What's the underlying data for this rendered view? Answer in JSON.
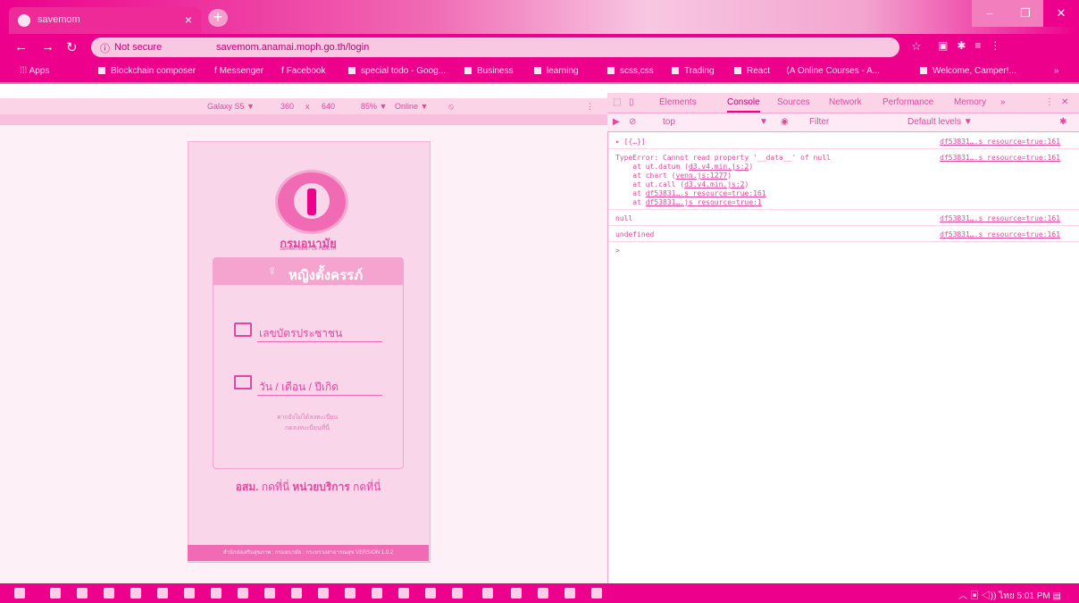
{
  "browser": {
    "tab_title": "savemom",
    "url_security": "Not secure",
    "url": "savemom.anamai.moph.go.th/login",
    "bookmarks": [
      "Apps",
      "Blockchain composer",
      "Messenger",
      "Facebook",
      "special todo - Goog...",
      "Business",
      "learning",
      "scss,css",
      "Trading",
      "React",
      "Online Courses - A...",
      "Welcome, Camper!..."
    ]
  },
  "device_toolbar": {
    "device": "Galaxy S5 ▼",
    "width": "360",
    "times": "x",
    "height": "640",
    "zoom": "85% ▼",
    "network": "Online ▼"
  },
  "login": {
    "dept_name": "กรมอนามัย",
    "dept_en": "DEPARTMENT OF HEALTH",
    "card_title": "หญิงตั้งครรภ์",
    "id_placeholder": "เลขบัตรประชาชน",
    "dob_placeholder": "วัน / เดือน / ปีเกิด",
    "note1": "หากยังไม่ได้ลงทะเบียน",
    "note2": "กดลงทะเบียนที่นี่",
    "link_osm": "อสม.",
    "link_osm_click": "กดที่นี่",
    "link_unit": "หน่วยบริการ",
    "link_unit_click": "กดที่นี่",
    "footer": "สำนักส่งเสริมสุขภาพ : กรมอนามัย : กระทรวงสาธารณสุข VERSION 1.0.2"
  },
  "devtools": {
    "tabs": [
      "Elements",
      "Console",
      "Sources",
      "Network",
      "Performance",
      "Memory",
      "»"
    ],
    "context": "top",
    "filter_placeholder": "Filter",
    "levels": "Default levels ▼",
    "console": {
      "row1": "▸ [{…}]",
      "row1_src": "df53831….s_resource=true:161",
      "err": "TypeError: Cannot read property '__data__' of null",
      "err_src": "df53831….s_resource=true:161",
      "st1_pre": "    at ut.datum (",
      "st1_link": "d3.v4.min.js:2",
      "st2_pre": "    at chart (",
      "st2_link": "venn.js:1277",
      "st3_pre": "    at ut.call (",
      "st3_link": "d3.v4.min.js:2",
      "st4_pre": "    at ",
      "st4_link": "df53831….s_resource=true:161",
      "st5_pre": "    at ",
      "st5_link": "df53831….js_resource=true:1",
      "row_null": "null",
      "row_null_src": "df53831….s_resource=true:161",
      "row_undef": "undefined",
      "row_undef_src": "df53831….s_resource=true:161",
      "prompt": ">"
    }
  },
  "taskbar": {
    "lang": "ไทย",
    "time": "5:01 PM"
  },
  "colors": {
    "accent": "#ec008c",
    "light": "#fde3f1"
  }
}
